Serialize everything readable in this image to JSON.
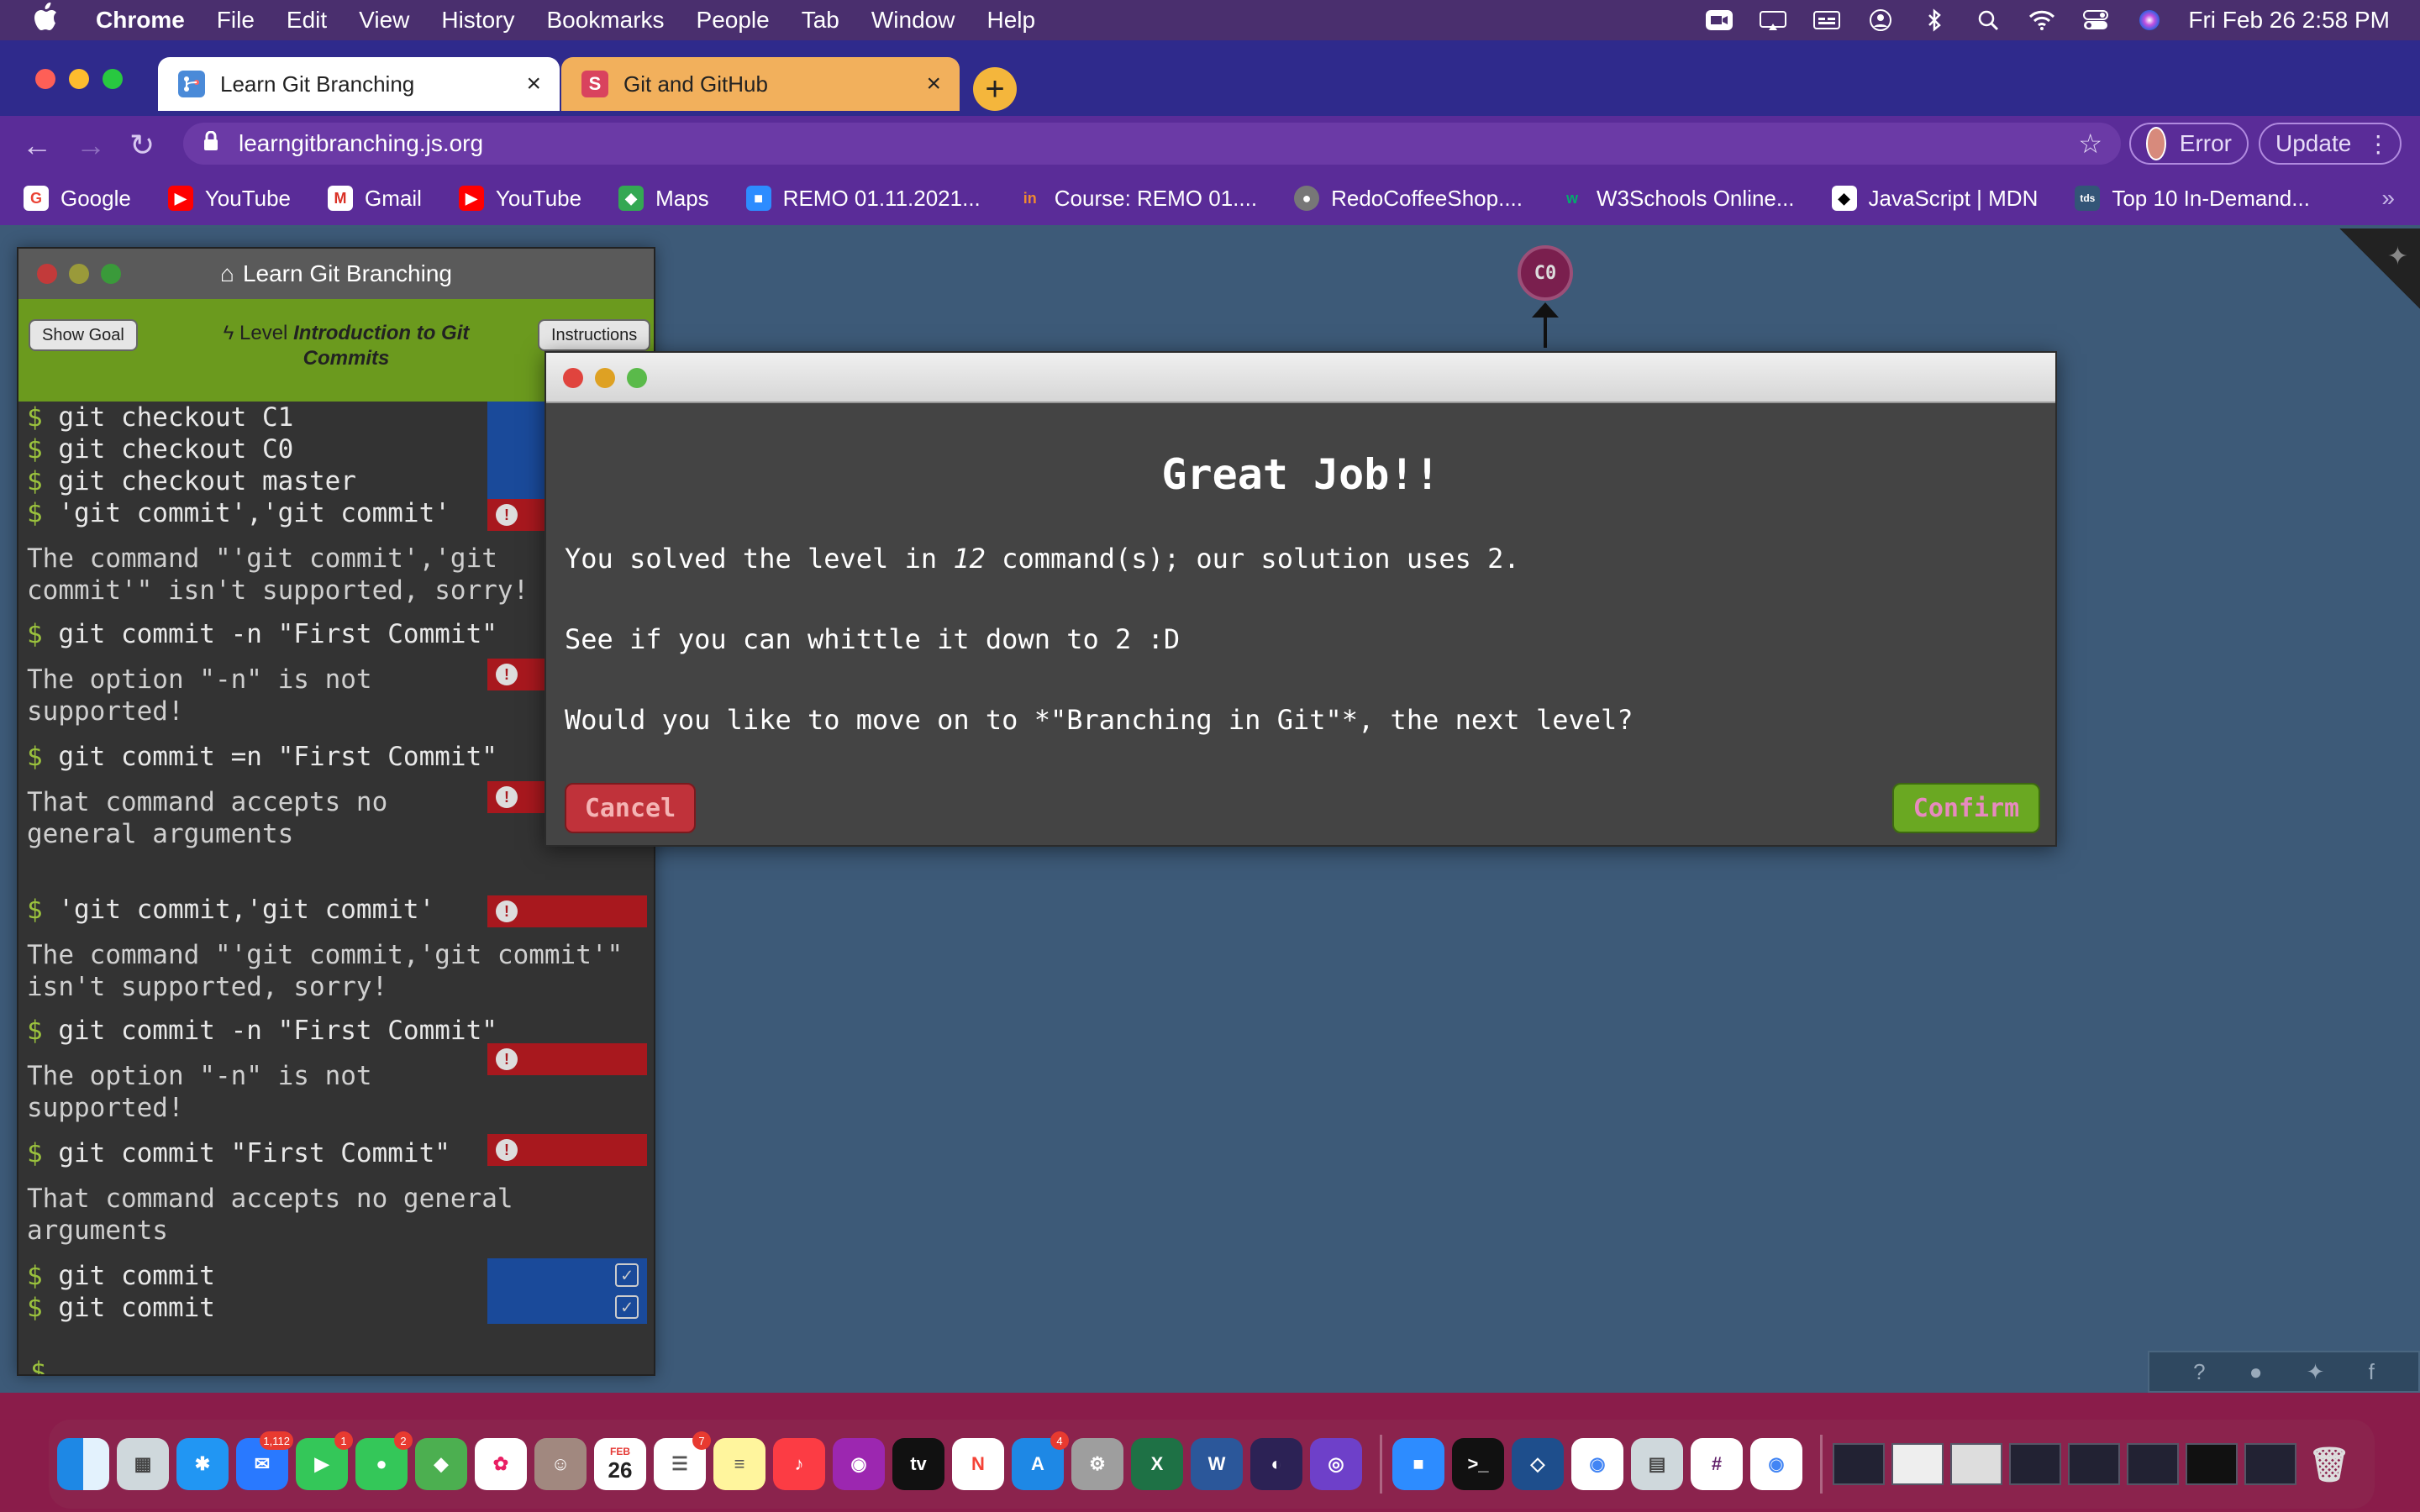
{
  "menubar": {
    "apple": "",
    "items": [
      "Chrome",
      "File",
      "Edit",
      "View",
      "History",
      "Bookmarks",
      "People",
      "Tab",
      "Window",
      "Help"
    ],
    "clock": "Fri Feb 26  2:58 PM"
  },
  "tabs": [
    {
      "title": "Learn Git Branching",
      "favicon": "git-branch-icon"
    },
    {
      "title": "Git and GitHub",
      "favicon_letter": "S"
    }
  ],
  "omnibox": {
    "url": "learngitbranching.js.org"
  },
  "profile": {
    "error_label": "Error",
    "update_label": "Update"
  },
  "bookmarks": [
    {
      "label": "Google",
      "icon": "G",
      "color": "#ea4335"
    },
    {
      "label": "YouTube",
      "icon": "▶",
      "color": "#ff0000"
    },
    {
      "label": "Gmail",
      "icon": "M",
      "color": "#d93025"
    },
    {
      "label": "YouTube",
      "icon": "▶",
      "color": "#ff0000"
    },
    {
      "label": "Maps",
      "icon": "◆",
      "color": "#34a853"
    },
    {
      "label": "REMO 01.11.2021...",
      "icon": "■",
      "color": "#2d8cff"
    },
    {
      "label": "Course: REMO 01....",
      "icon": "in",
      "color": "#e07020"
    },
    {
      "label": "RedoCoffeeShop....",
      "icon": "●",
      "color": "#777777"
    },
    {
      "label": "W3Schools Online...",
      "icon": "w",
      "color": "#04aa6d"
    },
    {
      "label": "JavaScript | MDN",
      "icon": "◆",
      "color": "#000000"
    },
    {
      "label": "Top 10 In-Demand...",
      "icon": "tds",
      "color": "#335577"
    }
  ],
  "command_panel": {
    "title": "Learn Git Branching",
    "show_goal": "Show Goal",
    "instructions": "Instructions",
    "level_prefix": "Level",
    "level_name": "Introduction to Git Commits",
    "prompt": "$"
  },
  "log": {
    "c1": "git checkout C1",
    "c2": "git checkout C0",
    "c3": "git checkout master",
    "c4": "'git commit','git commit'",
    "m4": "The command \"'git commit','git\ncommit'\" isn't supported, sorry!",
    "c5": "git commit -n \"First Commit\"",
    "m5": "The option \"-n\" is not\nsupported!",
    "c6": "git commit =n \"First Commit\"",
    "m6": "That command accepts no\ngeneral arguments",
    "c7": "'git commit,'git commit'",
    "m7": "The command \"'git commit,'git commit'\"\nisn't supported, sorry!",
    "c8": "git commit -n \"First Commit\"",
    "m8": "The option \"-n\" is not\nsupported!",
    "c9": "git commit \"First Commit\"",
    "m9": "That command accepts no general\narguments",
    "c10": "git commit",
    "c11": "git commit"
  },
  "graph": {
    "node_label": "C0"
  },
  "modal": {
    "title": "Great Job!!",
    "line1_a": "You solved the level in ",
    "line1_count": "12",
    "line1_b": " command(s); our solution uses 2.",
    "line2": "See if you can whittle it down to 2 :D",
    "line3": "Would you like to move on to *\"Branching in Git\"*, the next level?",
    "cancel": "Cancel",
    "confirm": "Confirm"
  },
  "dock": {
    "badges": {
      "mail": "1,112",
      "facetime": "1",
      "messages": "2",
      "calendar_day": "26",
      "calendar_month": "FEB",
      "reminders": "7",
      "appstore": "4"
    }
  },
  "colors": {
    "accent_green": "#6b9a1e",
    "error_red": "#a8181e",
    "ok_blue": "#1a4a9a",
    "canvas": "#3d5a78"
  }
}
